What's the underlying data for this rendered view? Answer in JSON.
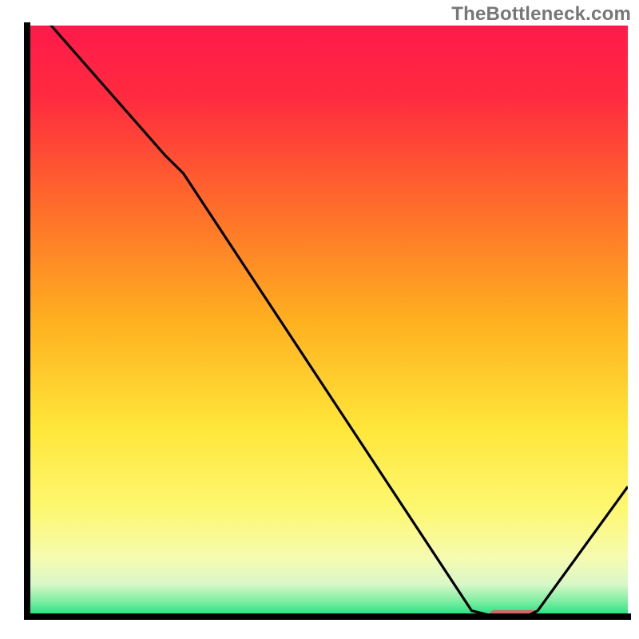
{
  "watermark": "TheBottleneck.com",
  "chart_data": {
    "type": "line",
    "title": "",
    "xlabel": "",
    "ylabel": "",
    "xlim": [
      0,
      100
    ],
    "ylim": [
      0,
      100
    ],
    "x": [
      0,
      4,
      23,
      26,
      74,
      78,
      83,
      85,
      100
    ],
    "values": [
      104,
      100,
      78,
      75,
      1,
      0,
      0,
      1,
      22
    ],
    "optimal_zone": {
      "x_start": 77,
      "x_end": 85,
      "y": 0.3
    },
    "gradient_stops": [
      {
        "offset": 0.0,
        "color": "#ff1a4b"
      },
      {
        "offset": 0.12,
        "color": "#ff2a3f"
      },
      {
        "offset": 0.3,
        "color": "#ff6a2b"
      },
      {
        "offset": 0.5,
        "color": "#ffb020"
      },
      {
        "offset": 0.68,
        "color": "#ffe639"
      },
      {
        "offset": 0.82,
        "color": "#fdf872"
      },
      {
        "offset": 0.9,
        "color": "#f6fbb0"
      },
      {
        "offset": 0.945,
        "color": "#d9f7c8"
      },
      {
        "offset": 0.975,
        "color": "#7aeea0"
      },
      {
        "offset": 1.0,
        "color": "#18e07e"
      }
    ],
    "marker_color": "#d06868",
    "line_color": "#000000",
    "axis_color": "#000000"
  }
}
